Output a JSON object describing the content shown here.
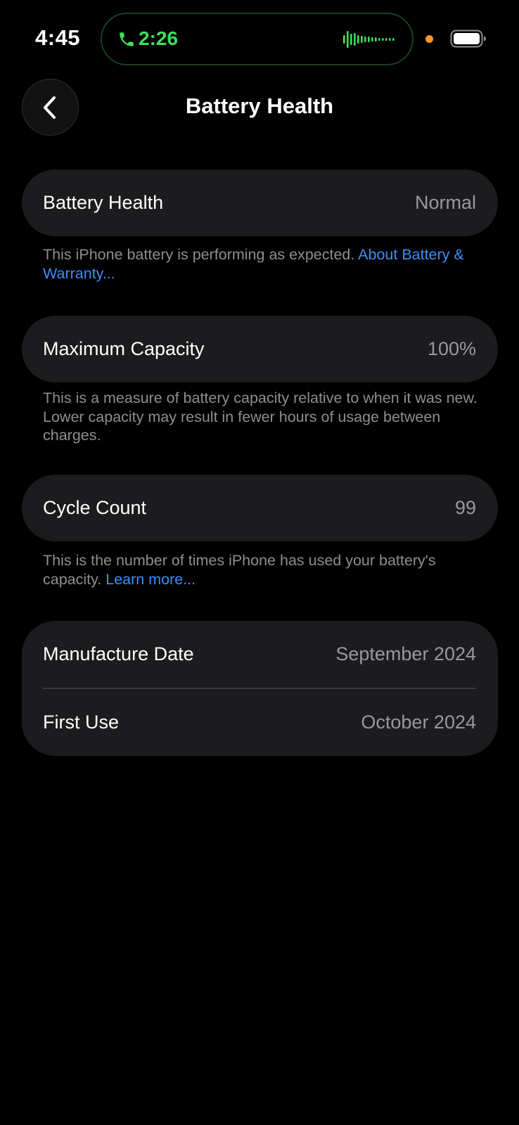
{
  "status_bar": {
    "time": "4:45",
    "call_timer": "2:26",
    "call_icon": "phone-icon",
    "waveform_icon": "audio-waveform-icon",
    "battery_icon": "battery-icon",
    "accent_green": "#3ee05a",
    "privacy_dot_color": "#f7962d"
  },
  "nav": {
    "back_icon": "chevron-left-icon",
    "title": "Battery Health"
  },
  "sections": {
    "health": {
      "label": "Battery Health",
      "value": "Normal",
      "footnote_text": "This iPhone battery is performing as expected. ",
      "footnote_link": "About Battery & Warranty..."
    },
    "capacity": {
      "label": "Maximum Capacity",
      "value": "100%",
      "footnote_text": "This is a measure of battery capacity relative to when it was new. Lower capacity may result in fewer hours of usage between charges."
    },
    "cycles": {
      "label": "Cycle Count",
      "value": "99",
      "footnote_text": "This is the number of times iPhone has used your battery's capacity. ",
      "footnote_link": "Learn more..."
    },
    "dates": {
      "manufacture_label": "Manufacture Date",
      "manufacture_value": "September 2024",
      "first_use_label": "First Use",
      "first_use_value": "October 2024"
    }
  },
  "colors": {
    "background": "#000000",
    "card": "#1c1c1e",
    "secondary_text": "#98989e",
    "link": "#3d8ef7"
  }
}
